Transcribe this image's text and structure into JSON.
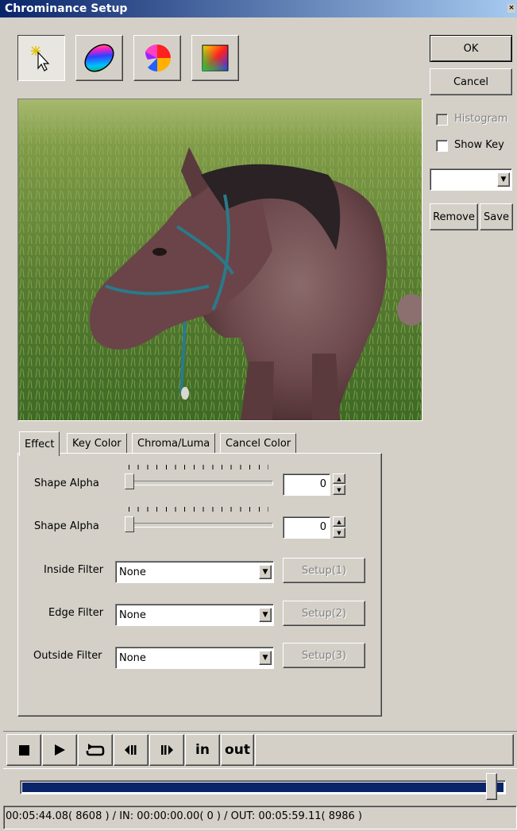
{
  "window": {
    "title": "Chrominance Setup",
    "close_label": "×"
  },
  "toolbar": {
    "tools": [
      {
        "name": "pointer-tool",
        "icon": "cursor-sparkle-icon"
      },
      {
        "name": "ellipse-color-tool",
        "icon": "color-ellipse-icon"
      },
      {
        "name": "hue-wheel-tool",
        "icon": "hue-wheel-icon"
      },
      {
        "name": "color-square-tool",
        "icon": "color-square-icon"
      }
    ]
  },
  "side_panel": {
    "ok_label": "OK",
    "cancel_label": "Cancel",
    "histogram_label": "Histogram",
    "show_key_label": "Show Key",
    "preset_value": "",
    "remove_label": "Remove",
    "save_label": "Save"
  },
  "preview": {
    "image_subject": "horse grazing in grass field"
  },
  "tabs": [
    {
      "label": "Effect",
      "active": true
    },
    {
      "label": "Key Color"
    },
    {
      "label": "Chroma/Luma"
    },
    {
      "label": "Cancel Color"
    }
  ],
  "effect": {
    "sliders": [
      {
        "label": "Shape Alpha",
        "value": "0",
        "position": 0
      },
      {
        "label": "Shape Alpha",
        "value": "0",
        "position": 0
      }
    ],
    "filters": [
      {
        "label": "Inside Filter",
        "value": "None",
        "setup_label": "Setup(1)"
      },
      {
        "label": "Edge Filter",
        "value": "None",
        "setup_label": "Setup(2)"
      },
      {
        "label": "Outside Filter",
        "value": "None",
        "setup_label": "Setup(3)"
      }
    ]
  },
  "transport": {
    "in_label": "in",
    "out_label": "out",
    "timeline_position": 0.97
  },
  "status": {
    "text": "00:05:44.08( 8608 ) / IN: 00:00:00.00( 0 ) / OUT: 00:05:59.11( 8986 )"
  },
  "colors": {
    "title_start": "#0a246a",
    "title_end": "#a6caf0",
    "timeline_fill": "#0a246a"
  }
}
